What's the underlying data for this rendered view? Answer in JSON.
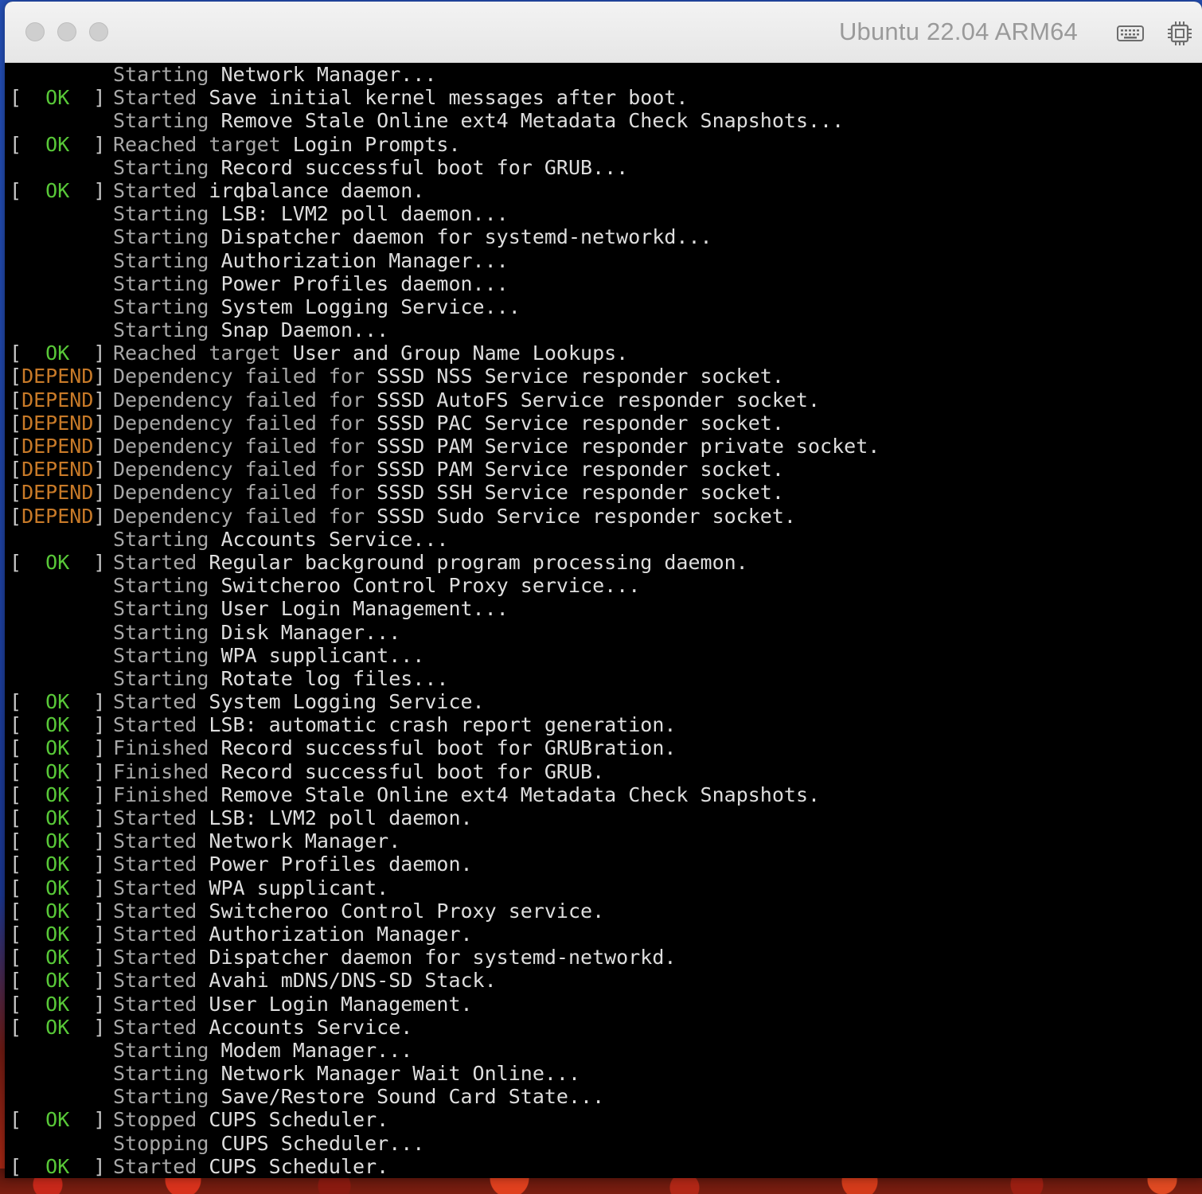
{
  "window": {
    "title": "Ubuntu 22.04 ARM64",
    "icons": [
      "keyboard-icon",
      "cpu-chip-icon"
    ]
  },
  "colors": {
    "ok": "#58c838",
    "depend": "#c87a28",
    "text": "#dedede",
    "verb": "#a8a8a8",
    "background": "#000000"
  },
  "console": {
    "lines": [
      {
        "status": "",
        "verb": "Starting",
        "text": "Network Manager..."
      },
      {
        "status": "OK",
        "verb": "Started",
        "text": "Save initial kernel messages after boot."
      },
      {
        "status": "",
        "verb": "Starting",
        "text": "Remove Stale Online ext4 Metadata Check Snapshots..."
      },
      {
        "status": "OK",
        "verb": "Reached target",
        "text": "Login Prompts."
      },
      {
        "status": "",
        "verb": "Starting",
        "text": "Record successful boot for GRUB..."
      },
      {
        "status": "OK",
        "verb": "Started",
        "text": "irqbalance daemon."
      },
      {
        "status": "",
        "verb": "Starting",
        "text": "LSB: LVM2 poll daemon..."
      },
      {
        "status": "",
        "verb": "Starting",
        "text": "Dispatcher daemon for systemd-networkd..."
      },
      {
        "status": "",
        "verb": "Starting",
        "text": "Authorization Manager..."
      },
      {
        "status": "",
        "verb": "Starting",
        "text": "Power Profiles daemon..."
      },
      {
        "status": "",
        "verb": "Starting",
        "text": "System Logging Service..."
      },
      {
        "status": "",
        "verb": "Starting",
        "text": "Snap Daemon..."
      },
      {
        "status": "OK",
        "verb": "Reached target",
        "text": "User and Group Name Lookups."
      },
      {
        "status": "DEPEND",
        "verb": "Dependency failed for",
        "text": "SSSD NSS Service responder socket."
      },
      {
        "status": "DEPEND",
        "verb": "Dependency failed for",
        "text": "SSSD AutoFS Service responder socket."
      },
      {
        "status": "DEPEND",
        "verb": "Dependency failed for",
        "text": "SSSD PAC Service responder socket."
      },
      {
        "status": "DEPEND",
        "verb": "Dependency failed for",
        "text": "SSSD PAM Service responder private socket."
      },
      {
        "status": "DEPEND",
        "verb": "Dependency failed for",
        "text": "SSSD PAM Service responder socket."
      },
      {
        "status": "DEPEND",
        "verb": "Dependency failed for",
        "text": "SSSD SSH Service responder socket."
      },
      {
        "status": "DEPEND",
        "verb": "Dependency failed for",
        "text": "SSSD Sudo Service responder socket."
      },
      {
        "status": "",
        "verb": "Starting",
        "text": "Accounts Service..."
      },
      {
        "status": "OK",
        "verb": "Started",
        "text": "Regular background program processing daemon."
      },
      {
        "status": "",
        "verb": "Starting",
        "text": "Switcheroo Control Proxy service..."
      },
      {
        "status": "",
        "verb": "Starting",
        "text": "User Login Management..."
      },
      {
        "status": "",
        "verb": "Starting",
        "text": "Disk Manager..."
      },
      {
        "status": "",
        "verb": "Starting",
        "text": "WPA supplicant..."
      },
      {
        "status": "",
        "verb": "Starting",
        "text": "Rotate log files..."
      },
      {
        "status": "OK",
        "verb": "Started",
        "text": "System Logging Service."
      },
      {
        "status": "OK",
        "verb": "Started",
        "text": "LSB: automatic crash report generation."
      },
      {
        "status": "OK",
        "verb": "Finished",
        "text": "Record successful boot for GRUBration."
      },
      {
        "status": "OK",
        "verb": "Finished",
        "text": "Record successful boot for GRUB."
      },
      {
        "status": "OK",
        "verb": "Finished",
        "text": "Remove Stale Online ext4 Metadata Check Snapshots."
      },
      {
        "status": "OK",
        "verb": "Started",
        "text": "LSB: LVM2 poll daemon."
      },
      {
        "status": "OK",
        "verb": "Started",
        "text": "Network Manager."
      },
      {
        "status": "OK",
        "verb": "Started",
        "text": "Power Profiles daemon."
      },
      {
        "status": "OK",
        "verb": "Started",
        "text": "WPA supplicant."
      },
      {
        "status": "OK",
        "verb": "Started",
        "text": "Switcheroo Control Proxy service."
      },
      {
        "status": "OK",
        "verb": "Started",
        "text": "Authorization Manager."
      },
      {
        "status": "OK",
        "verb": "Started",
        "text": "Dispatcher daemon for systemd-networkd."
      },
      {
        "status": "OK",
        "verb": "Started",
        "text": "Avahi mDNS/DNS-SD Stack."
      },
      {
        "status": "OK",
        "verb": "Started",
        "text": "User Login Management."
      },
      {
        "status": "OK",
        "verb": "Started",
        "text": "Accounts Service."
      },
      {
        "status": "",
        "verb": "Starting",
        "text": "Modem Manager..."
      },
      {
        "status": "",
        "verb": "Starting",
        "text": "Network Manager Wait Online..."
      },
      {
        "status": "",
        "verb": "Starting",
        "text": "Save/Restore Sound Card State..."
      },
      {
        "status": "OK",
        "verb": "Stopped",
        "text": "CUPS Scheduler."
      },
      {
        "status": "",
        "verb": "Stopping",
        "text": "CUPS Scheduler..."
      },
      {
        "status": "OK",
        "verb": "Started",
        "text": "CUPS Scheduler."
      }
    ]
  }
}
